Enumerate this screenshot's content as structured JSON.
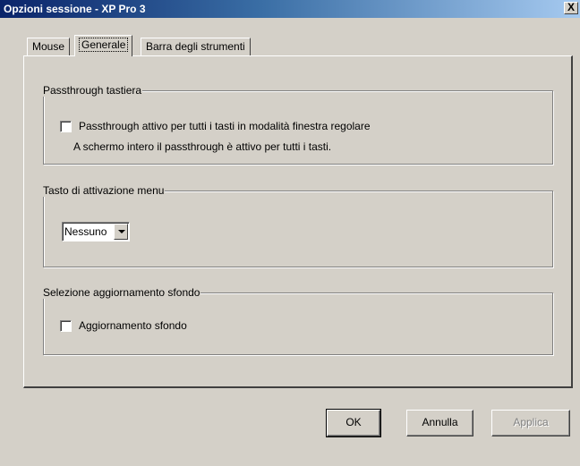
{
  "window": {
    "title": "Opzioni sessione - XP Pro 3",
    "close_label": "X"
  },
  "tabs": [
    {
      "label": "Mouse",
      "active": false
    },
    {
      "label": "Generale",
      "active": true
    },
    {
      "label": "Barra degli strumenti",
      "active": false
    }
  ],
  "keyboard_passthrough": {
    "title": "Passthrough tastiera",
    "checkbox_label": "Passthrough attivo per tutti i tasti in modalità finestra regolare",
    "checked": false,
    "note": "A schermo intero il passthrough è attivo per tutti i tasti."
  },
  "menu_key": {
    "title": "Tasto di attivazione menu",
    "selected": "Nessuno"
  },
  "background_update": {
    "title": "Selezione aggiornamento sfondo",
    "checkbox_label": "Aggiornamento sfondo",
    "checked": false
  },
  "buttons": {
    "ok": "OK",
    "cancel": "Annulla",
    "apply": "Applica"
  }
}
